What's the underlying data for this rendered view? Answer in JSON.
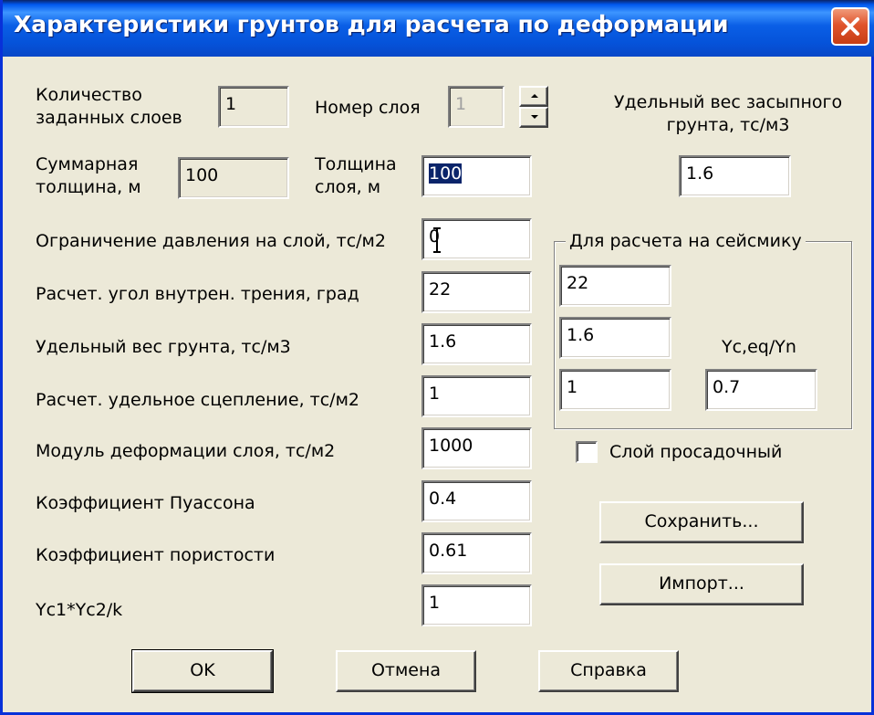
{
  "window": {
    "title": "Характеристики грунтов для расчета по деформации"
  },
  "labels": {
    "layers_count": "Количество\nзаданных слоев",
    "layer_number": "Номер слоя",
    "backfill_weight": "Удельный вес засыпного\nгрунта, тс/м3",
    "total_thickness": "Суммарная\nтолщина, м",
    "layer_thickness": "Толщина\nслоя,  м",
    "pressure_limit": "Ограничение давления на слой, тс/м2",
    "friction_angle": "Расчет. угол внутрен. трения, град",
    "soil_weight": "Удельный вес грунта, тс/м3",
    "cohesion": "Расчет. удельное сцепление, тс/м2",
    "deformation_modulus": "Модуль деформации слоя, тс/м2",
    "poisson": "Коэффициент Пуассона",
    "porosity": "Коэффициент пористости",
    "yc_k": "Yc1*Yc2/k",
    "seismic_ratio": "Yc,eq/Yn"
  },
  "fields": {
    "layers_count": "1",
    "layer_number": "1",
    "backfill_weight": "1.6",
    "total_thickness": "100",
    "layer_thickness": "100",
    "pressure_limit": "0",
    "friction_angle": "22",
    "soil_weight": "1.6",
    "cohesion": "1",
    "deformation_modulus": "1000",
    "poisson": "0.4",
    "porosity": "0.61",
    "yc_k": "1"
  },
  "seismic": {
    "title": "Для расчета на сейсмику",
    "friction_angle": "22",
    "soil_weight": "1.6",
    "cohesion": "1",
    "ratio": "0.7"
  },
  "checkbox": {
    "label": "Слой просадочный",
    "checked": false
  },
  "buttons": {
    "save": "Сохранить...",
    "import": "Импорт...",
    "ok": "OK",
    "cancel": "Отмена",
    "help": "Справка"
  },
  "colors": {
    "titlebar": "#0553da",
    "close": "#e0542c",
    "dialog_bg": "#ece9d8"
  },
  "icons": {
    "close": "close-icon",
    "spin_up": "arrow-up-icon",
    "spin_down": "arrow-down-icon",
    "caret": "text-cursor-icon"
  }
}
